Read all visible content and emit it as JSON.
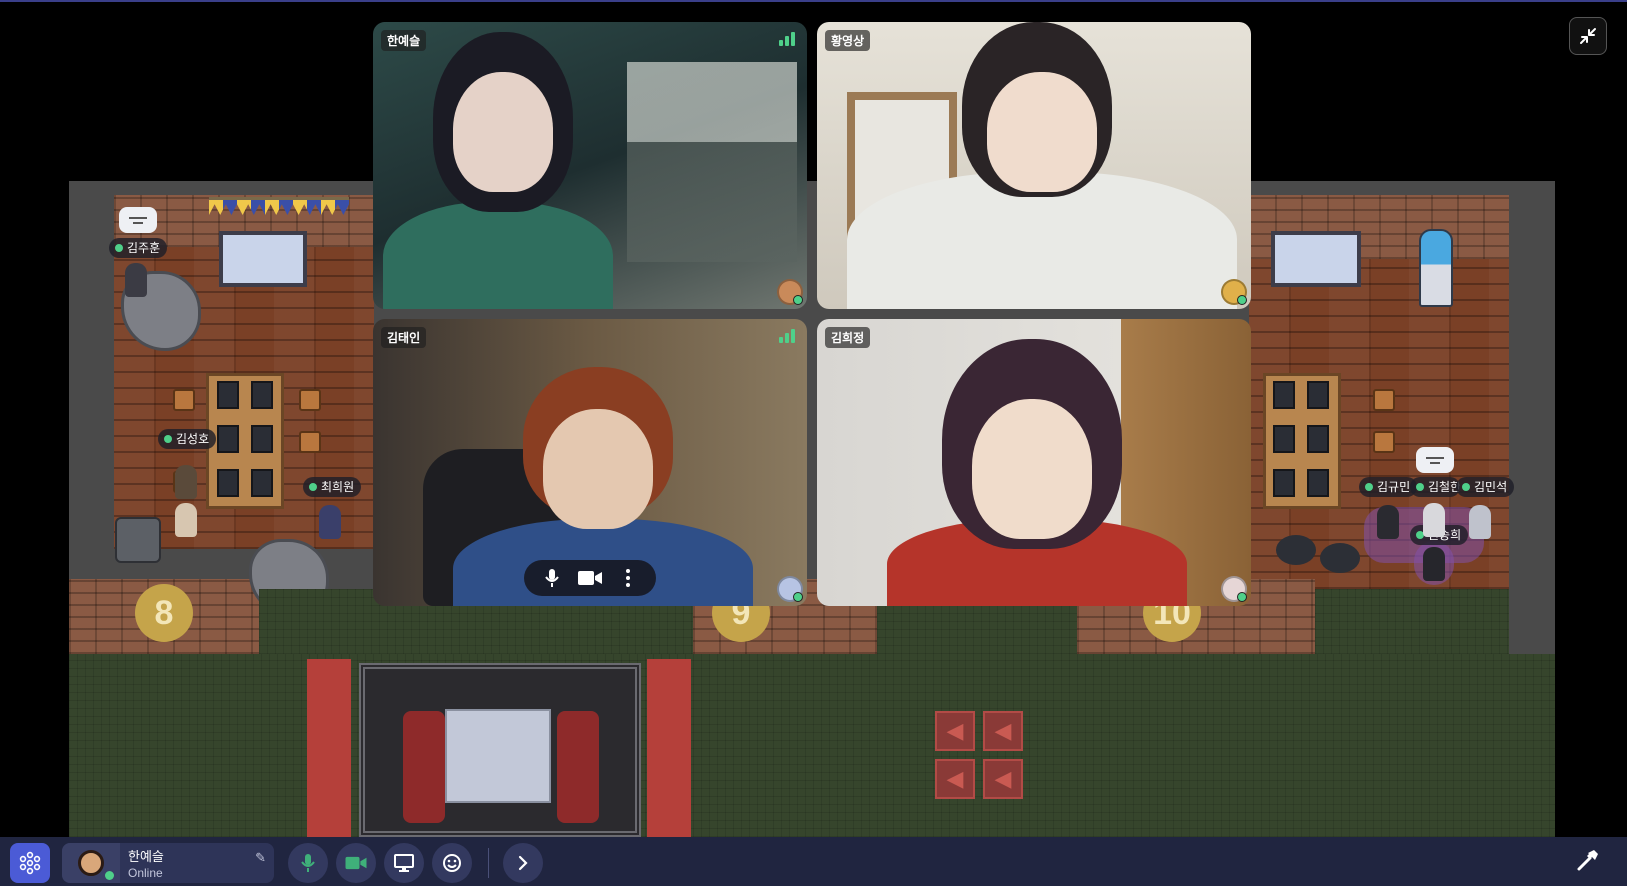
{
  "video_tiles": [
    {
      "name": "한예슬",
      "signal": true
    },
    {
      "name": "황영상",
      "signal": false
    },
    {
      "name": "김태인",
      "signal": true
    },
    {
      "name": "김희정",
      "signal": false
    }
  ],
  "map": {
    "room_numbers": [
      "8",
      "9",
      "10"
    ],
    "name_tags": {
      "kim_juhun": "김주훈",
      "kim_seongho": "김성호",
      "choi_huiwon": "최희원",
      "kim_gyumin": "김규민",
      "kim_cheolhan": "김철한",
      "kim_minseok": "김민석",
      "won_songhui": "원송희"
    }
  },
  "bottom_bar": {
    "user_name": "한예슬",
    "user_status": "Online"
  },
  "colors": {
    "accent": "#4b5bd6",
    "bar_bg": "#202540",
    "online": "#4fd08a",
    "mic_green": "#3fb07a"
  },
  "icons": {
    "collapse": "collapse-icon",
    "logo": "gather-logo-icon",
    "mic": "microphone-icon",
    "camera": "camera-icon",
    "screen_share": "screen-share-icon",
    "emoji": "emoji-icon",
    "expand": "chevron-right-icon",
    "build": "hammer-icon"
  }
}
